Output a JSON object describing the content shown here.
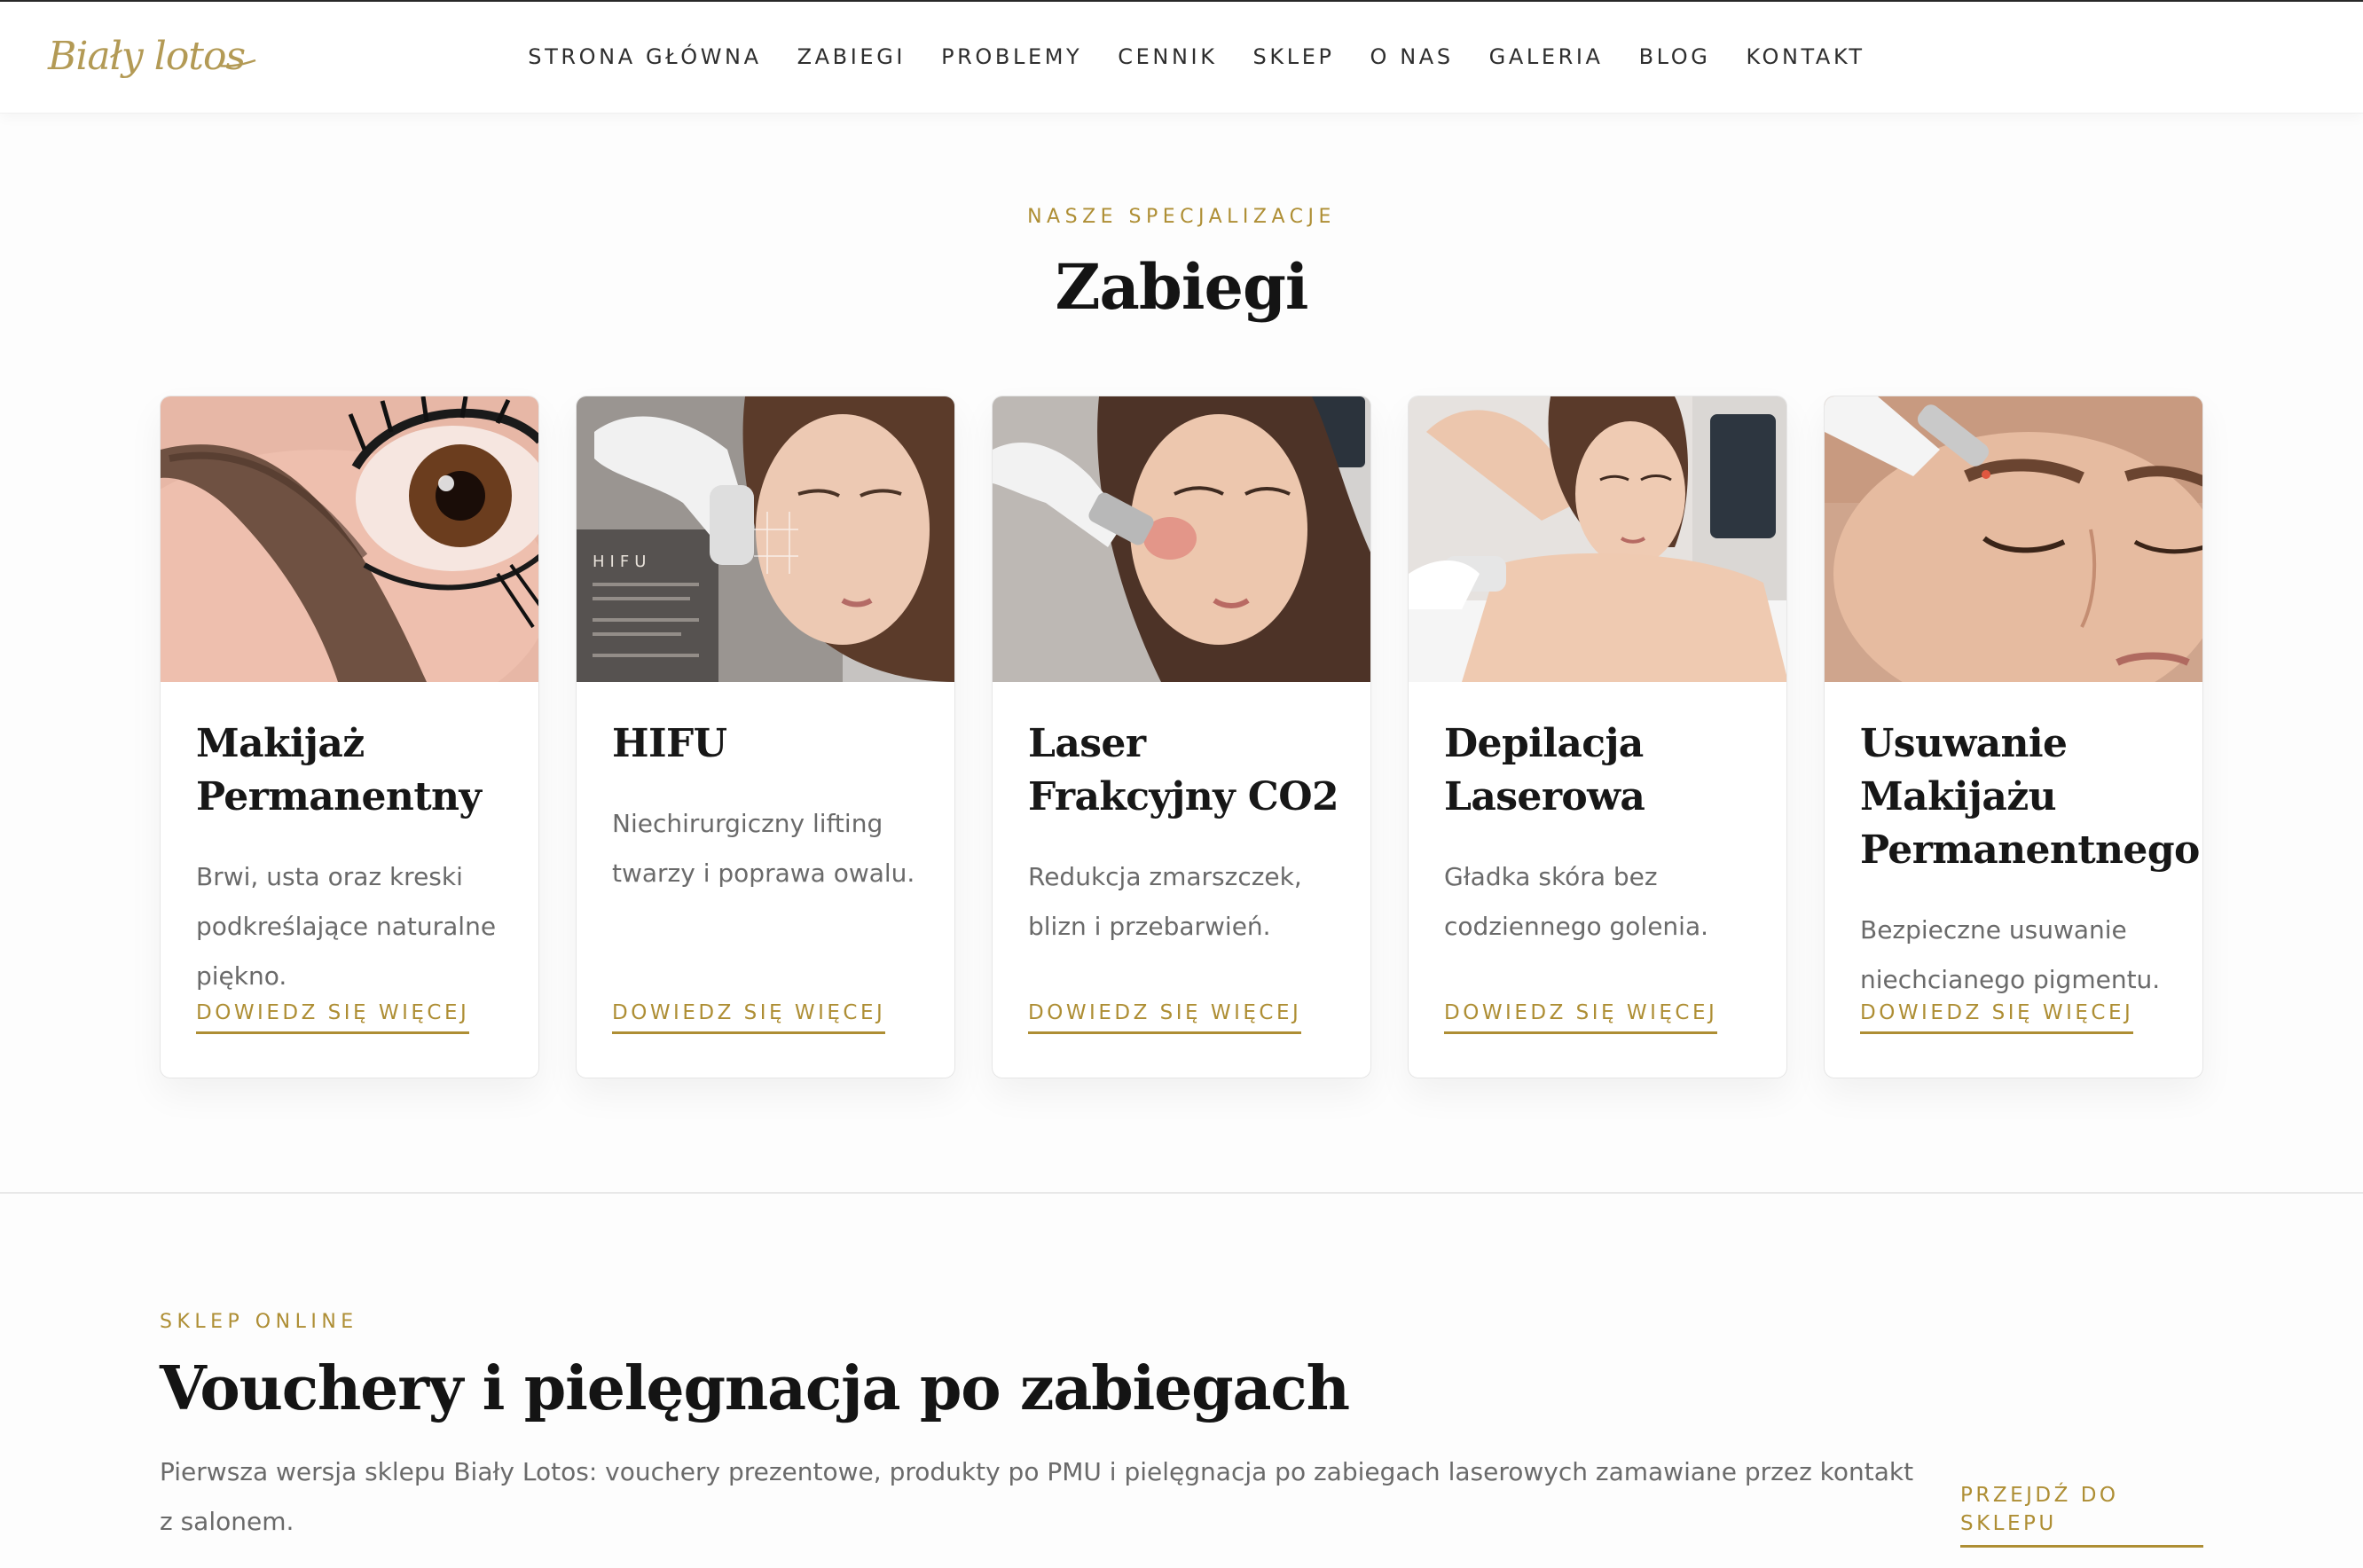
{
  "header": {
    "logo_text": "Biały lotos",
    "nav": [
      "STRONA GŁÓWNA",
      "ZABIEGI",
      "PROBLEMY",
      "CENNIK",
      "SKLEP",
      "O NAS",
      "GALERIA",
      "BLOG",
      "KONTAKT"
    ]
  },
  "treatments": {
    "eyebrow": "NASZE SPECJALIZACJE",
    "title": "Zabiegi",
    "cards": [
      {
        "title": "Makijaż Permanentny",
        "description": "Brwi, usta oraz kreski podkreślające naturalne piękno.",
        "link": "DOWIEDZ SIĘ WIĘCEJ",
        "image": "eyebrow-closeup-photo"
      },
      {
        "title": "HIFU",
        "description": "Niechirurgiczny lifting twarzy i poprawa owalu.",
        "link": "DOWIEDZ SIĘ WIĘCEJ",
        "image": "hifu-treatment-photo",
        "image_caption": "HIFU"
      },
      {
        "title": "Laser Frakcyjny CO2",
        "description": "Redukcja zmarszczek, blizn i przebarwień.",
        "link": "DOWIEDZ SIĘ WIĘCEJ",
        "image": "co2-laser-photo"
      },
      {
        "title": "Depilacja Laserowa",
        "description": "Gładka skóra bez codziennego golenia.",
        "link": "DOWIEDZ SIĘ WIĘCEJ",
        "image": "laser-hair-removal-photo"
      },
      {
        "title": "Usuwanie Makijażu Permanentnego",
        "description": "Bezpieczne usuwanie niechcianego pigmentu.",
        "link": "DOWIEDZ SIĘ WIĘCEJ",
        "image": "pigment-removal-photo"
      }
    ]
  },
  "shop": {
    "eyebrow": "SKLEP ONLINE",
    "title": "Vouchery i pielęgnacja po zabiegach",
    "description": "Pierwsza wersja sklepu Biały Lotos: vouchery prezentowe, produkty po PMU i pielęgnacja po zabiegach laserowych zamawiane przez kontakt z salonem.",
    "link": "PRZEJDŹ DO SKLEPU"
  },
  "colors": {
    "accent": "#ae8e34",
    "text": "#141414",
    "muted": "#6a6a6a",
    "border": "#e6e6e6"
  }
}
